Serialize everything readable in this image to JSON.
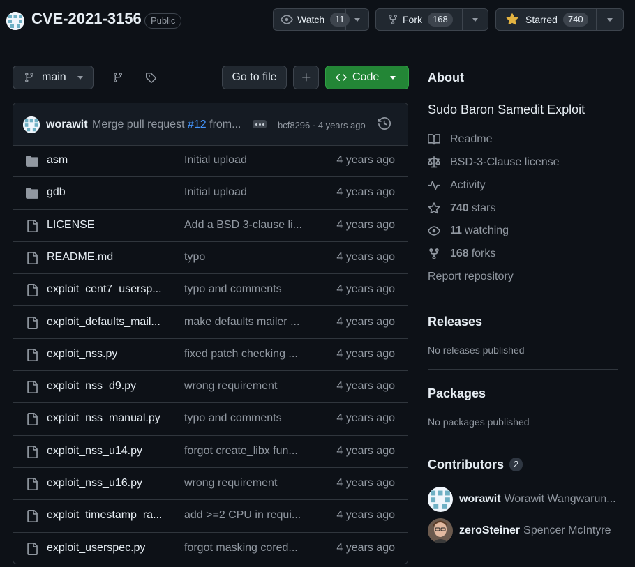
{
  "repo": {
    "name": "CVE-2021-3156",
    "visibility": "Public"
  },
  "header_actions": {
    "watch": {
      "label": "Watch",
      "count": "11"
    },
    "fork": {
      "label": "Fork",
      "count": "168"
    },
    "star": {
      "label": "Starred",
      "count": "740"
    }
  },
  "toolbar": {
    "branch": "main",
    "go_to_file": "Go to file",
    "add": "+",
    "code": "Code"
  },
  "latest_commit": {
    "author": "worawit",
    "message_prefix": "Merge pull request ",
    "message_link": "#12",
    "message_suffix": " from...",
    "meta": "bcf8296 · 4 years ago"
  },
  "files": [
    {
      "name": "asm",
      "type": "folder",
      "message": "Initial upload",
      "date": "4 years ago"
    },
    {
      "name": "gdb",
      "type": "folder",
      "message": "Initial upload",
      "date": "4 years ago"
    },
    {
      "name": "LICENSE",
      "type": "file",
      "message": "Add a BSD 3-clause li...",
      "date": "4 years ago"
    },
    {
      "name": "README.md",
      "type": "file",
      "message": "typo",
      "date": "4 years ago"
    },
    {
      "name": "exploit_cent7_usersp...",
      "type": "file",
      "message": "typo and comments",
      "date": "4 years ago"
    },
    {
      "name": "exploit_defaults_mail...",
      "type": "file",
      "message": "make defaults mailer ...",
      "date": "4 years ago"
    },
    {
      "name": "exploit_nss.py",
      "type": "file",
      "message": "fixed patch checking ...",
      "date": "4 years ago"
    },
    {
      "name": "exploit_nss_d9.py",
      "type": "file",
      "message": "wrong requirement",
      "date": "4 years ago"
    },
    {
      "name": "exploit_nss_manual.py",
      "type": "file",
      "message": "typo and comments",
      "date": "4 years ago"
    },
    {
      "name": "exploit_nss_u14.py",
      "type": "file",
      "message": "forgot create_libx fun...",
      "date": "4 years ago"
    },
    {
      "name": "exploit_nss_u16.py",
      "type": "file",
      "message": "wrong requirement",
      "date": "4 years ago"
    },
    {
      "name": "exploit_timestamp_ra...",
      "type": "file",
      "message": "add >=2 CPU in requi...",
      "date": "4 years ago"
    },
    {
      "name": "exploit_userspec.py",
      "type": "file",
      "message": "forgot masking cored...",
      "date": "4 years ago"
    }
  ],
  "about": {
    "heading": "About",
    "description": "Sudo Baron Samedit Exploit",
    "readme": "Readme",
    "license": "BSD-3-Clause license",
    "activity": "Activity",
    "stars_count": "740",
    "stars_label": "stars",
    "watching_count": "11",
    "watching_label": "watching",
    "forks_count": "168",
    "forks_label": "forks",
    "report": "Report repository"
  },
  "releases": {
    "heading": "Releases",
    "empty": "No releases published"
  },
  "packages": {
    "heading": "Packages",
    "empty": "No packages published"
  },
  "contributors": {
    "heading": "Contributors",
    "count": "2",
    "people": [
      {
        "login": "worawit",
        "name": "Worawit Wangwarun..."
      },
      {
        "login": "zeroSteiner",
        "name": "Spencer McIntyre"
      }
    ]
  },
  "colors": {
    "background": "#0d1117",
    "border": "#30363d",
    "text": "#e6edf3",
    "muted": "#9198a1",
    "link": "#4493f8",
    "green": "#238636",
    "star": "#e3b341"
  }
}
